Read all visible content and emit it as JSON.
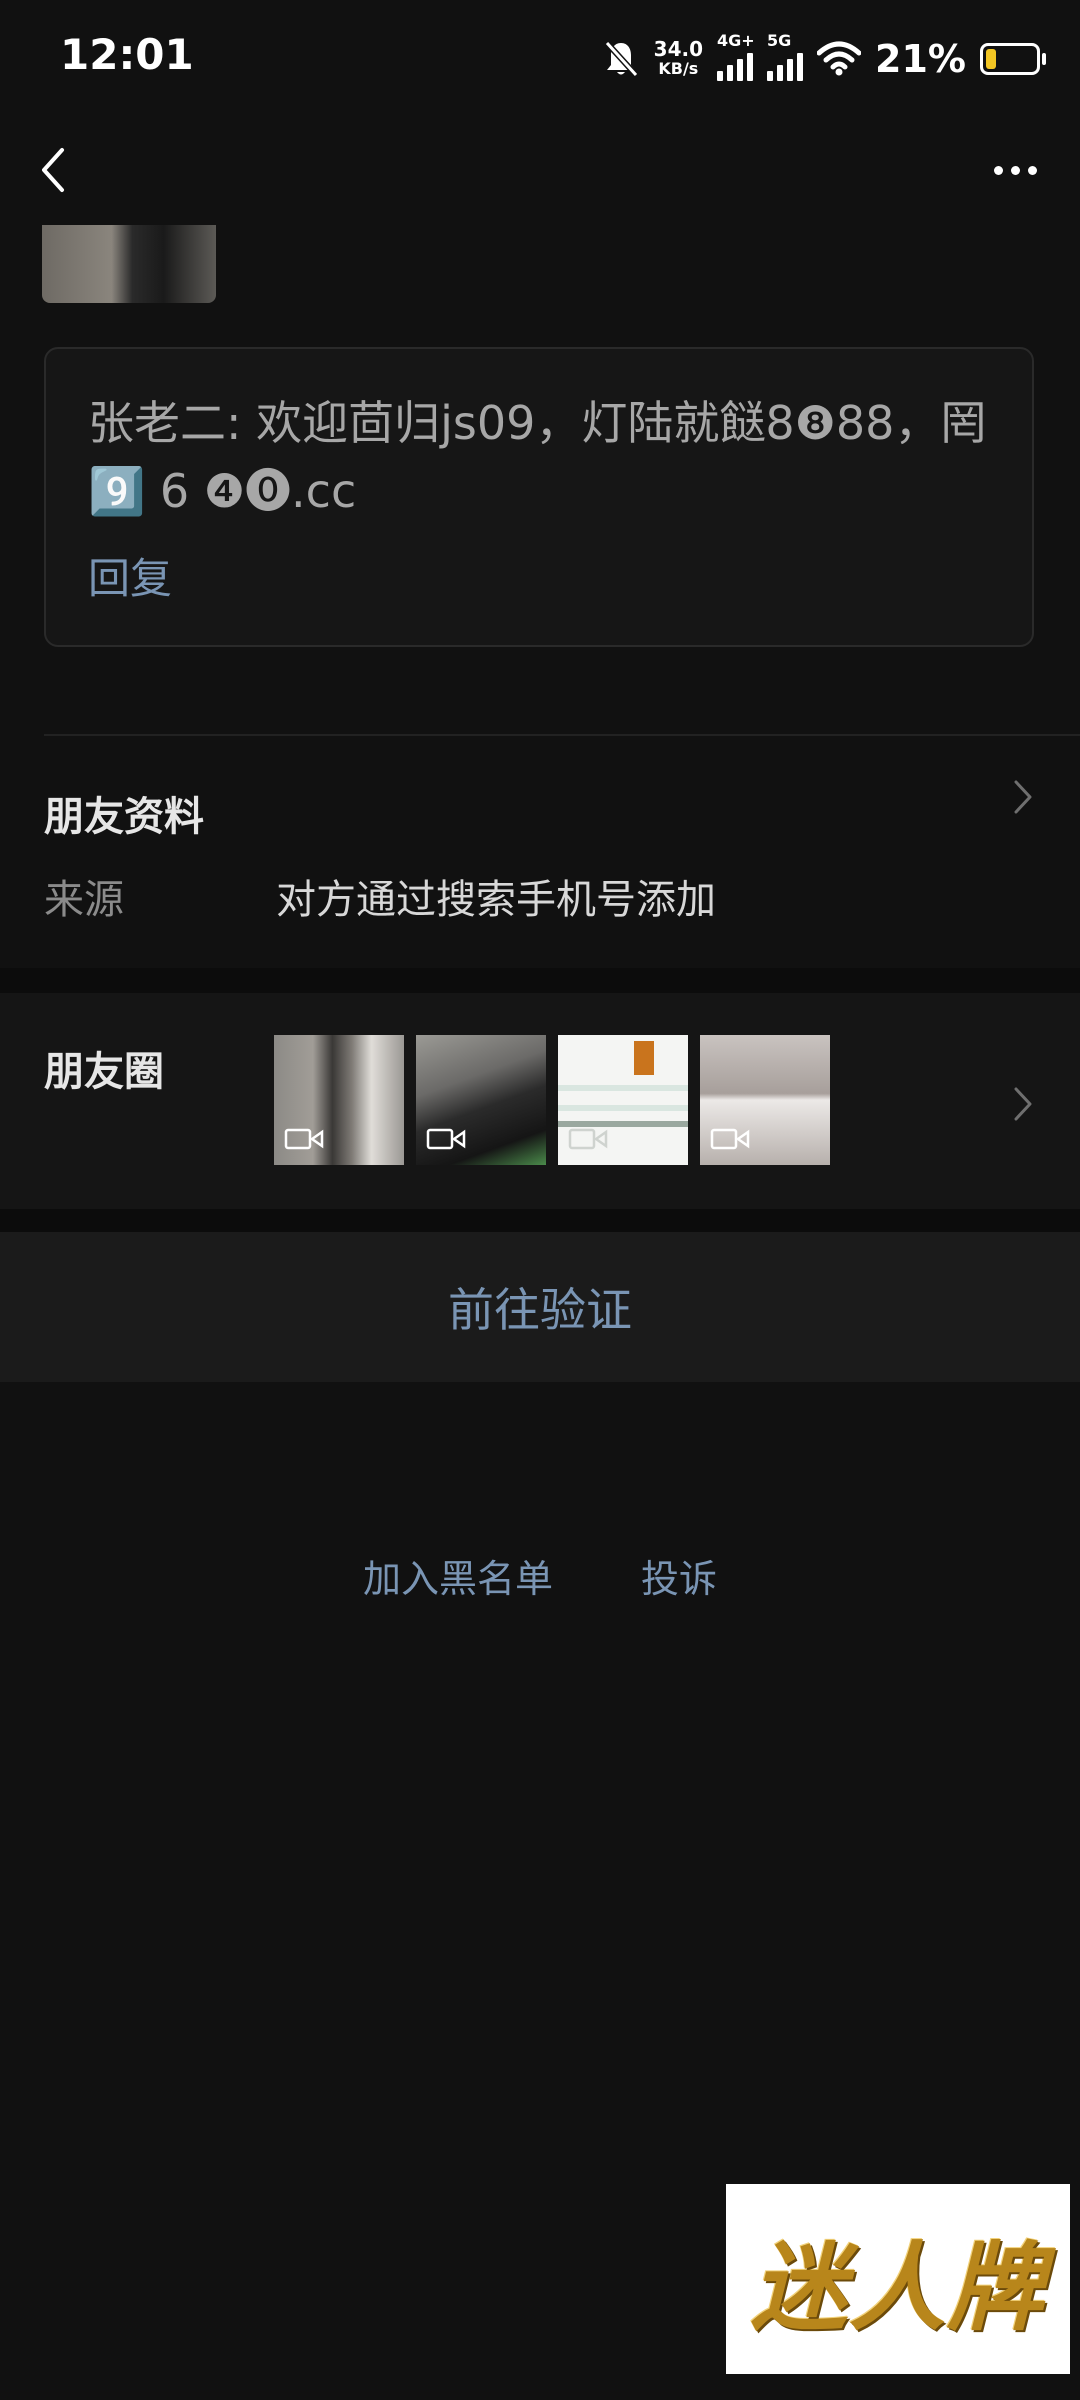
{
  "status_bar": {
    "time": "12:01",
    "net_speed_value": "34.0",
    "net_speed_unit": "KB/s",
    "signal1_label": "4G+",
    "signal2_label": "5G",
    "battery_percent": "21%",
    "battery_level": 0.21,
    "battery_color": "#f3c623"
  },
  "nav": {
    "back_icon": "chevron-left-icon",
    "more_icon": "more-horizontal-icon"
  },
  "message": {
    "text": "张老二: 欢迎茴归js09，灯陆就餸8❽88，罔9️⃣ 6 ❹⓿.cc",
    "reply_label": "回复"
  },
  "profile_section": {
    "title": "朋友资料",
    "source_label": "来源",
    "source_value": "对方通过搜索手机号添加"
  },
  "moments_section": {
    "title": "朋友圈",
    "thumbnail_count": 4
  },
  "actions": {
    "verify_label": "前往验证",
    "blacklist_label": "加入黑名单",
    "report_label": "投诉"
  },
  "watermark": {
    "text": "迷人牌"
  },
  "colors": {
    "background": "#111111",
    "link_blue": "#7a95b4",
    "battery_yellow": "#f3c623"
  }
}
